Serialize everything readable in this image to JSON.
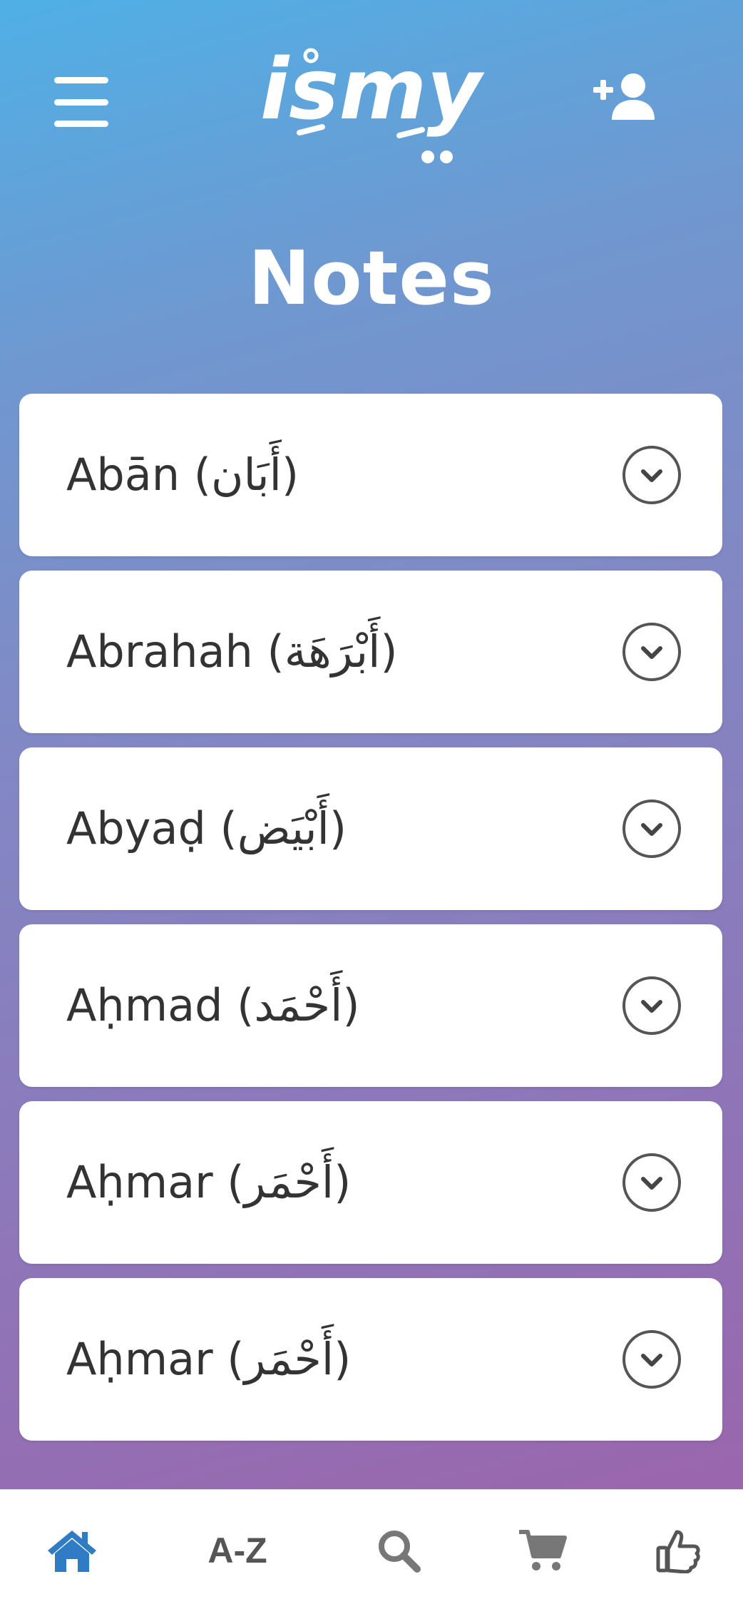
{
  "header": {
    "menu_icon": "hamburger-menu-icon",
    "logo_text": "ismy",
    "add_user_icon": "add-user-icon"
  },
  "page": {
    "title": "Notes"
  },
  "notes": [
    {
      "label": "Abān (أَبَان)"
    },
    {
      "label": "Abrahah (أَبْرَهَة)"
    },
    {
      "label": "Abyaḍ (أَبْيَض)"
    },
    {
      "label": "Aḥmad (أَحْمَد)"
    },
    {
      "label": "Aḥmar (أَحْمَر)"
    },
    {
      "label": "Aḥmar (أَحْمَر)"
    }
  ],
  "bottom_nav": {
    "items": [
      {
        "name": "home",
        "icon": "home-icon",
        "active": true
      },
      {
        "name": "a-z",
        "label": "A-Z"
      },
      {
        "name": "search",
        "icon": "search-icon"
      },
      {
        "name": "cart",
        "icon": "cart-icon"
      },
      {
        "name": "like",
        "icon": "thumbs-up-icon"
      }
    ]
  },
  "colors": {
    "gradient_top": "#4fb0e6",
    "gradient_bottom": "#9a66ad",
    "active_nav": "#2f7bc4",
    "inactive_nav": "#555555",
    "card_text": "#333333"
  }
}
